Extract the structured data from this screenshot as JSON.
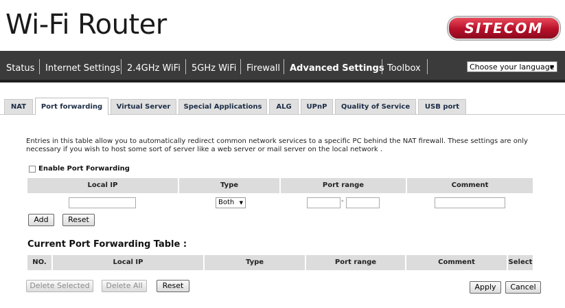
{
  "header": {
    "title": "Wi-Fi Router",
    "logo_text": "SITECOM"
  },
  "nav": {
    "items": [
      "Status",
      "Internet Settings",
      "2.4GHz WiFi",
      "5GHz WiFi",
      "Firewall",
      "Advanced Settings",
      "Toolbox"
    ],
    "active": "Advanced Settings",
    "language_select": "Choose your language"
  },
  "tabs": {
    "items": [
      "NAT",
      "Port forwarding",
      "Virtual Server",
      "Special Applications",
      "ALG",
      "UPnP",
      "Quality of Service",
      "USB port"
    ],
    "active": "Port forwarding"
  },
  "description": "Entries in this table allow you to automatically redirect common network services to a specific PC behind the NAT firewall. These settings are only necessary if you wish to host some sort of server like a web server or mail server on the local network .",
  "form": {
    "enable_label": "Enable Port Forwarding",
    "enable_checked": false,
    "columns": [
      "Local IP",
      "Type",
      "Port range",
      "Comment"
    ],
    "local_ip": "",
    "type_selected": "Both",
    "port_from": "",
    "port_separator": "-",
    "port_to": "",
    "comment": "",
    "add_label": "Add",
    "reset_label": "Reset"
  },
  "table": {
    "title": "Current Port Forwarding Table :",
    "columns": [
      "NO.",
      "Local IP",
      "Type",
      "Port range",
      "Comment",
      "Select"
    ],
    "rows": []
  },
  "footer": {
    "delete_selected": "Delete Selected",
    "delete_all": "Delete All",
    "reset": "Reset",
    "apply": "Apply",
    "cancel": "Cancel"
  },
  "colors": {
    "navbar": "#3b3b3b",
    "brand": "#c8102e",
    "tab_text": "#1b2c45",
    "header_cell": "#dcdcdc"
  }
}
